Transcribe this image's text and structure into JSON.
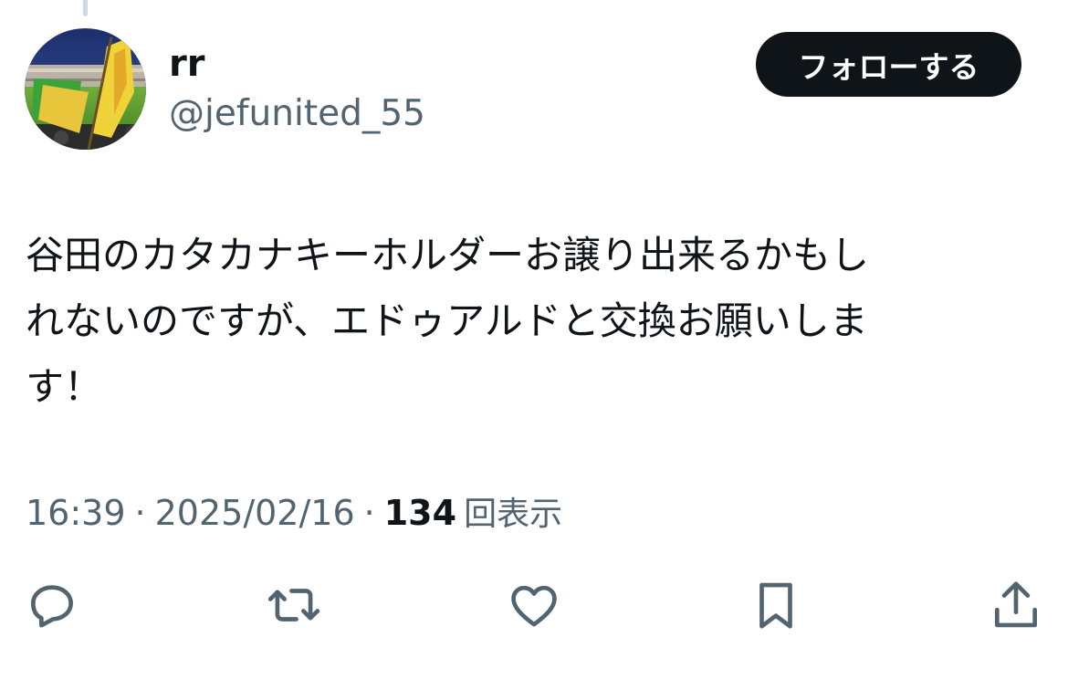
{
  "user": {
    "display_name": "rr",
    "handle": "@jefunited_55"
  },
  "follow_button": {
    "label": "フォローする"
  },
  "tweet": {
    "text": "谷田のカタカナキーホルダーお譲り出来るかもし\nれないのですが、エドゥアルドと交換お願いしま\nす！"
  },
  "meta": {
    "time": "16:39",
    "separator": "·",
    "date": "2025/02/16",
    "views_count": "134",
    "views_label": "回表示"
  },
  "actions": {
    "icons": [
      "reply-icon",
      "retweet-icon",
      "like-icon",
      "bookmark-icon",
      "share-icon"
    ]
  },
  "colors": {
    "text_primary": "#0f1419",
    "text_secondary": "#536471",
    "button_bg": "#0f1419",
    "button_text": "#ffffff",
    "thread_line": "#cfd9de"
  }
}
